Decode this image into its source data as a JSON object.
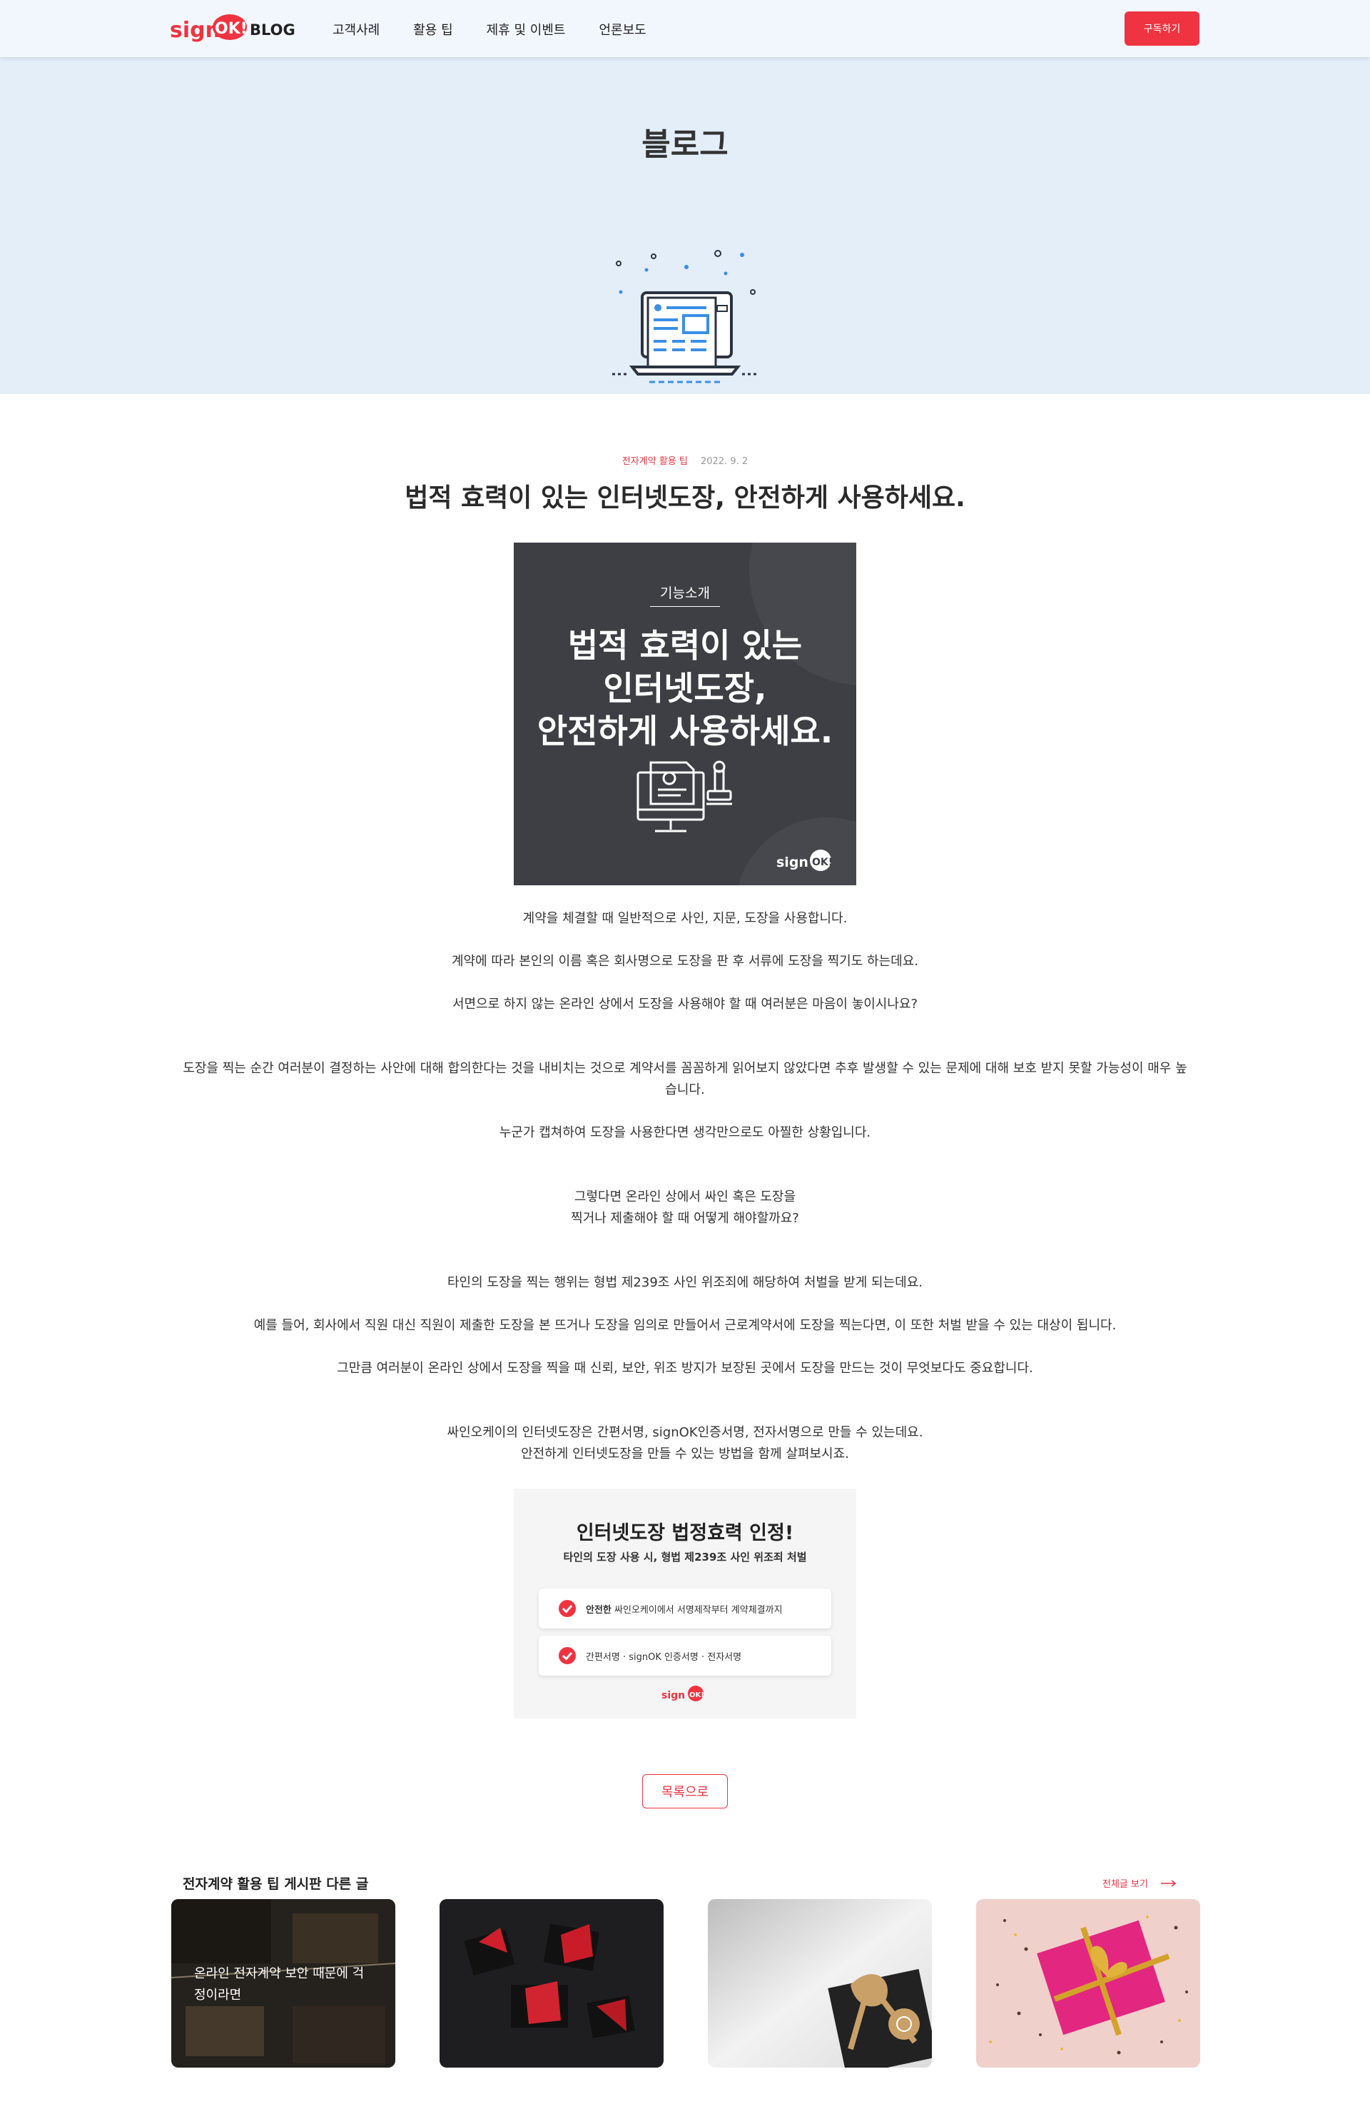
{
  "header": {
    "logo_text": "sign OK! BLOG",
    "nav": [
      "고객사례",
      "활용 팁",
      "제휴 및 이벤트",
      "언론보도"
    ],
    "subscribe_label": "구독하기"
  },
  "hero": {
    "title": "블로그"
  },
  "post": {
    "category": "전자계약 활용 팁",
    "date": "2022. 9. 2",
    "title": "법적 효력이 있는 인터넷도장, 안전하게 사용하세요."
  },
  "feature_image": {
    "badge": "기능소개",
    "lines": [
      "법적 효력이 있는",
      "인터넷도장,",
      "안전하게 사용하세요."
    ],
    "brand": "signOK!"
  },
  "body": {
    "p1": "계약을 체결할 때 일반적으로 사인, 지문, 도장을 사용합니다.",
    "p2": "계약에 따라 본인의 이름 혹은 회사명으로 도장을 판 후 서류에 도장을 찍기도 하는데요.",
    "p3": "서면으로 하지 않는 온라인 상에서 도장을 사용해야 할 때 여러분은 마음이 놓이시나요?",
    "p4": "도장을 찍는 순간 여러분이 결정하는 사안에 대해 합의한다는 것을 내비치는 것으로 계약서를 꼼꼼하게 읽어보지 않았다면 추후 발생할 수 있는 문제에 대해 보호 받지 못할 가능성이 매우 높습니다.",
    "p5": "누군가 캡쳐하여 도장을 사용한다면 생각만으로도 아찔한 상황입니다.",
    "p6a": "그렇다면 온라인 상에서 싸인 혹은 도장을",
    "p6b": "찍거나 제출해야 할 때 어떻게 해야할까요?",
    "p7": "타인의 도장을 찍는 행위는 형법 제239조 사인 위조죄에 해당하여 처벌을 받게 되는데요.",
    "p8": "예를 들어, 회사에서 직원 대신 직원이 제출한 도장을 본 뜨거나 도장을 임의로 만들어서 근로계약서에 도장을 찍는다면, 이 또한 처벌 받을 수 있는 대상이 됩니다.",
    "p9": "그만큼 여러분이 온라인 상에서 도장을 찍을 때 신뢰, 보안, 위조 방지가 보장된 곳에서 도장을 만드는 것이 무엇보다도 중요합니다.",
    "p10a": "싸인오케이의 인터넷도장은 간편서명, signOK인증서명, 전자서명으로 만들 수 있는데요.",
    "p10b": "안전하게 인터넷도장을 만들 수 있는 방법을 함께 살펴보시죠."
  },
  "info_card": {
    "title": "인터넷도장 법정효력 인정!",
    "subtitle": "타인의 도장 사용 시, 형법 제239조 사인 위조죄 처벌",
    "row1_bold": "안전한",
    "row1_text": " 싸인오케이에서 서명제작부터 계약체결까지",
    "row2_text": "간편서명 · signOK 인증서명 · 전자서명",
    "brand": "signOK!"
  },
  "list_button_label": "목록으로",
  "related": {
    "title": "전자계약 활용 팁 게시판 다른 글",
    "see_all": "전체글 보기",
    "cards": [
      {
        "caption_line1": "온라인 전자계약 보안 때문에 걱",
        "caption_line2": "정이라면"
      },
      {
        "caption_line1": "",
        "caption_line2": ""
      },
      {
        "caption_line1": "",
        "caption_line2": ""
      },
      {
        "caption_line1": "",
        "caption_line2": ""
      }
    ]
  },
  "colors": {
    "accent": "#ef3340",
    "hero_bg": "#e3eef9",
    "header_bg": "#f2f7fd",
    "feature_bg": "#3d3f44"
  }
}
